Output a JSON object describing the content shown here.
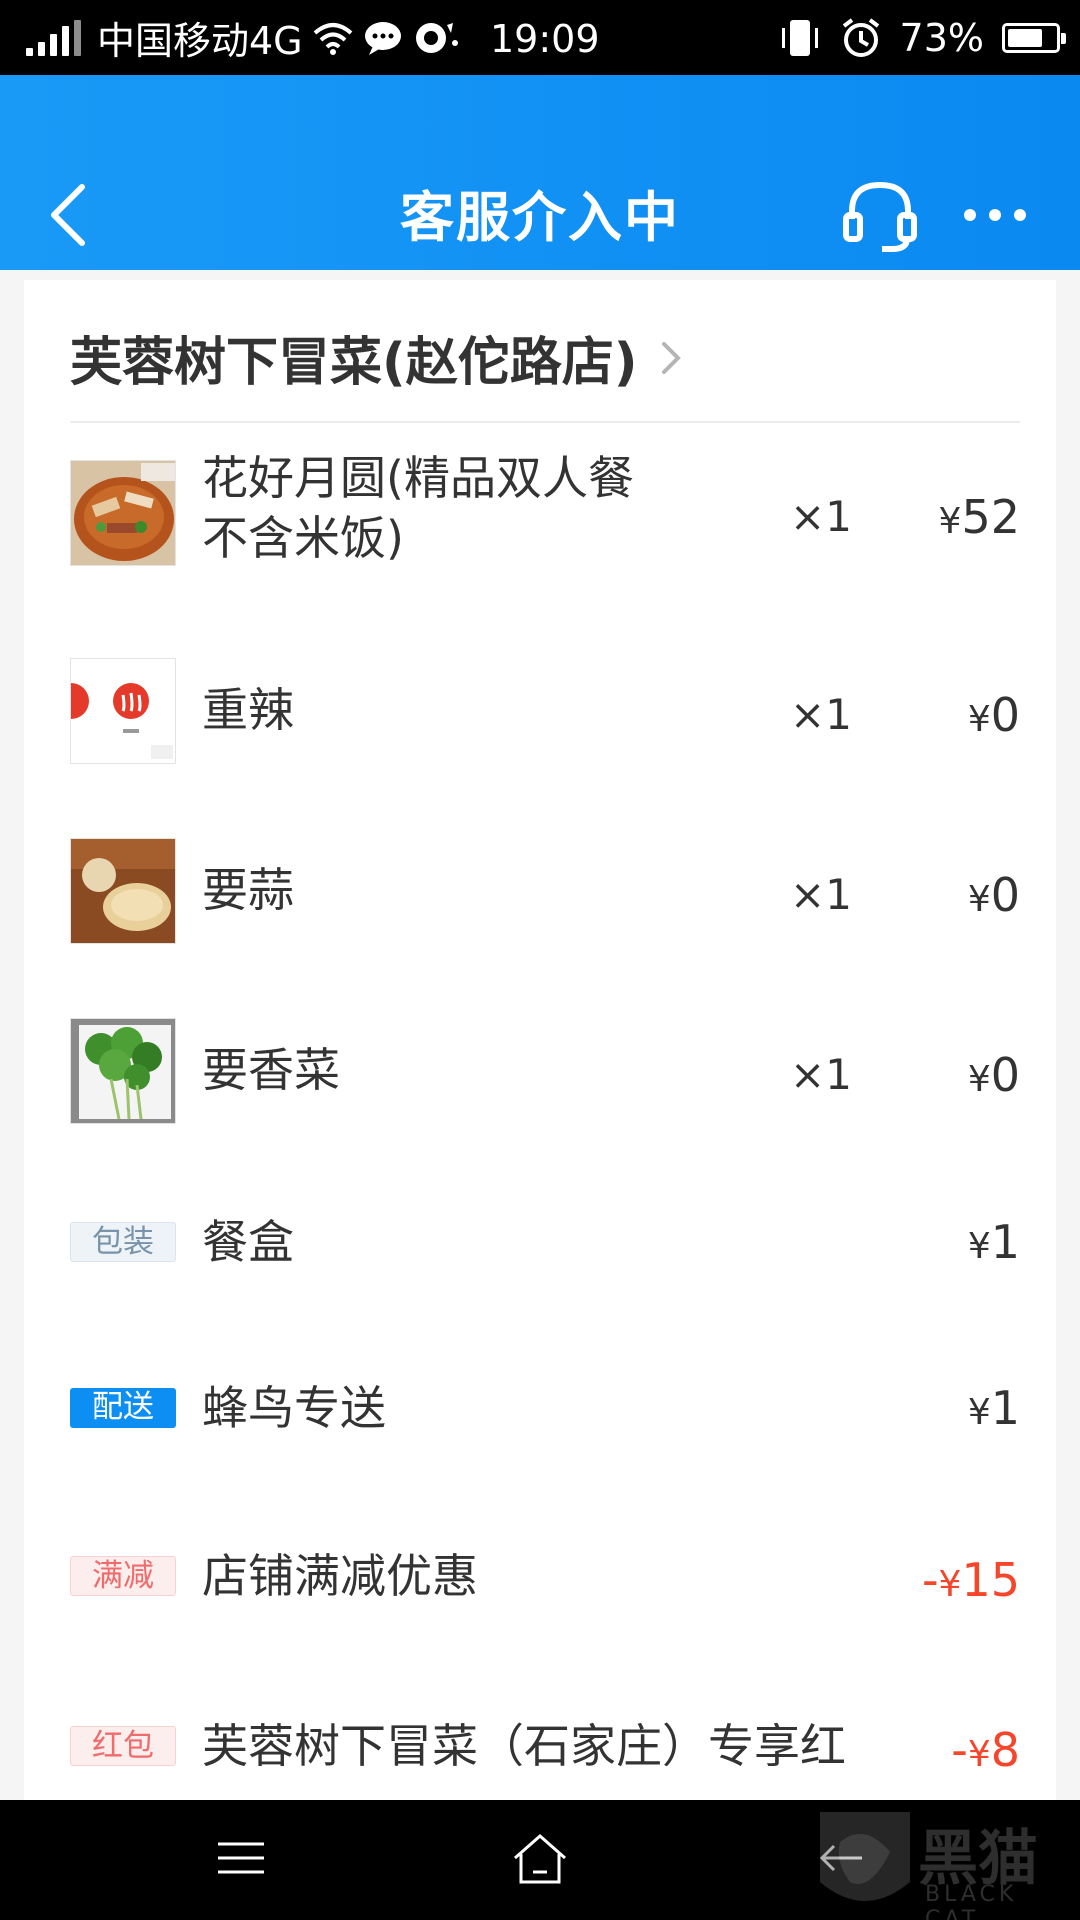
{
  "status_bar": {
    "carrier": "中国移动4G",
    "time": "19:09",
    "battery": "73%",
    "battery_level": 0.73
  },
  "header": {
    "title": "客服介入中",
    "icons": [
      "back-arrow-icon",
      "headset-icon",
      "more-dots-icon"
    ]
  },
  "order": {
    "shop_name": "芙蓉树下冒菜(赵佗路店)",
    "items": [
      {
        "name_line1": "花好月圆(精品双人餐",
        "name_line2": "不含米饭)",
        "qty": "×1",
        "price": "52",
        "currency": "¥"
      },
      {
        "name": "重辣",
        "qty": "×1",
        "price": "0",
        "currency": "¥"
      },
      {
        "name": "要蒜",
        "qty": "×1",
        "price": "0",
        "currency": "¥"
      },
      {
        "name": "要香菜",
        "qty": "×1",
        "price": "0",
        "currency": "¥"
      }
    ],
    "fees": [
      {
        "tag": "包装",
        "name": "餐盒",
        "price": "1",
        "currency": "¥"
      },
      {
        "tag": "配送",
        "name": "蜂鸟专送",
        "price": "1",
        "currency": "¥"
      }
    ],
    "discounts": [
      {
        "tag": "满减",
        "name": "店铺满减优惠",
        "price": "15",
        "sign": "-",
        "currency": "¥"
      },
      {
        "tag": "红包",
        "name": "芙蓉树下冒菜（石家庄）专享红",
        "price": "8",
        "sign": "-",
        "currency": "¥"
      }
    ]
  },
  "watermark": {
    "text": "黑猫",
    "subtext": "BLACK CAT"
  },
  "colors": {
    "header_blue": "#1a9af7",
    "discount_red": "#f5462c",
    "delivery_tag_blue": "#0d8ef2"
  }
}
